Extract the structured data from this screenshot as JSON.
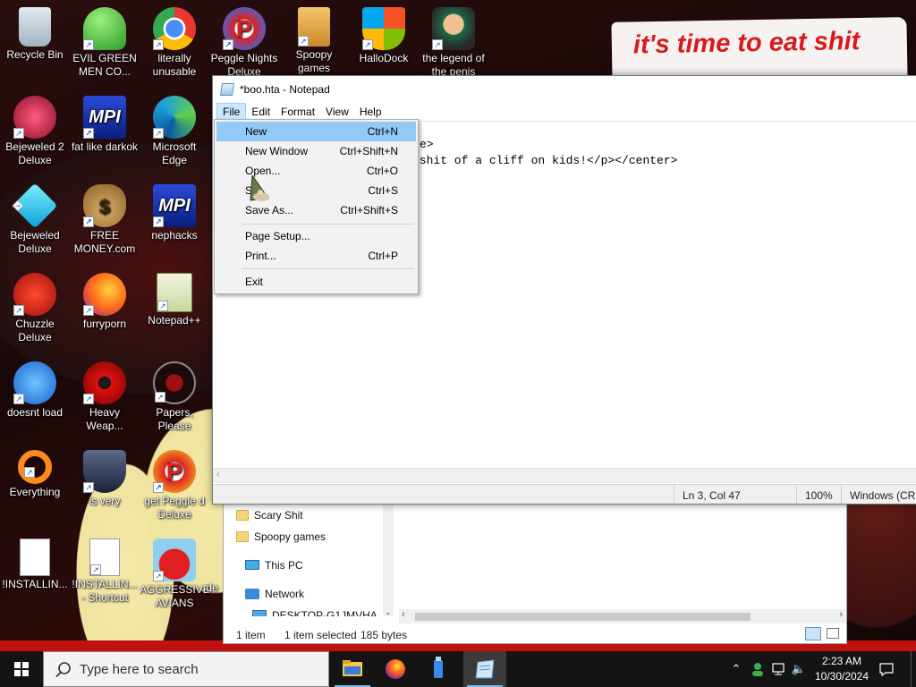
{
  "desktop": {
    "banner_text": "it's time to eat shit",
    "icons": [
      {
        "label": "Recycle Bin"
      },
      {
        "label": "EVIL GREEN MEN CO..."
      },
      {
        "label": "literally unusable"
      },
      {
        "label": "Peggle Nights Deluxe"
      },
      {
        "label": "Spoopy games"
      },
      {
        "label": "HalloDock"
      },
      {
        "label": "the legend of the penis"
      },
      {
        "label": "Bejeweled 2 Deluxe"
      },
      {
        "label": "fat like darkok"
      },
      {
        "label": "Microsoft Edge"
      },
      {
        "label": "Bejeweled Deluxe"
      },
      {
        "label": "FREE MONEY.com"
      },
      {
        "label": "nephacks"
      },
      {
        "label": "Chuzzle Deluxe"
      },
      {
        "label": "furryporn"
      },
      {
        "label": "Notepad++"
      },
      {
        "label": "doesnt load"
      },
      {
        "label": "Heavy Weap..."
      },
      {
        "label": "Papers, Please"
      },
      {
        "label": "Everything"
      },
      {
        "label": "is very"
      },
      {
        "label": "get Peggle d Deluxe"
      },
      {
        "label": "!INSTALLIN..."
      },
      {
        "label": "!INSTALLIN... - Shortcut"
      },
      {
        "label": "AGGRESSIVE AVIANS"
      },
      {
        "label": "de"
      }
    ]
  },
  "notepad": {
    "title": "*boo.hta - Notepad",
    "menu": [
      "File",
      "Edit",
      "Format",
      "View",
      "Help"
    ],
    "text_line1": "e>",
    "text_line2": " shit of a cliff on kids!</p></center>",
    "status": {
      "position": "Ln 3, Col 47",
      "zoom": "100%",
      "encoding": "Windows (CRL"
    }
  },
  "file_menu": {
    "items": [
      {
        "label": "New",
        "shortcut": "Ctrl+N"
      },
      {
        "label": "New Window",
        "shortcut": "Ctrl+Shift+N"
      },
      {
        "label": "Open...",
        "shortcut": "Ctrl+O"
      },
      {
        "label": "S",
        "shortcut": "Ctrl+S"
      },
      {
        "label": "Save As...",
        "shortcut": "Ctrl+Shift+S"
      },
      {
        "label": "Page Setup...",
        "shortcut": ""
      },
      {
        "label": "Print...",
        "shortcut": "Ctrl+P"
      },
      {
        "label": "Exit",
        "shortcut": ""
      }
    ]
  },
  "explorer": {
    "nav": [
      "Scary Shit",
      "Spoopy games",
      "This PC",
      "Network",
      "DESKTOP-G1JMVHA"
    ],
    "status": {
      "items": "1 item",
      "selected": "1 item selected",
      "size": "185 bytes"
    }
  },
  "taskbar": {
    "search_placeholder": "Type here to search",
    "time": "2:23 AM",
    "date": "10/30/2024"
  },
  "colors": {
    "menu_highlight": "#91c9f7",
    "banner_text": "#d91a1a",
    "taskbar": "#141414"
  }
}
